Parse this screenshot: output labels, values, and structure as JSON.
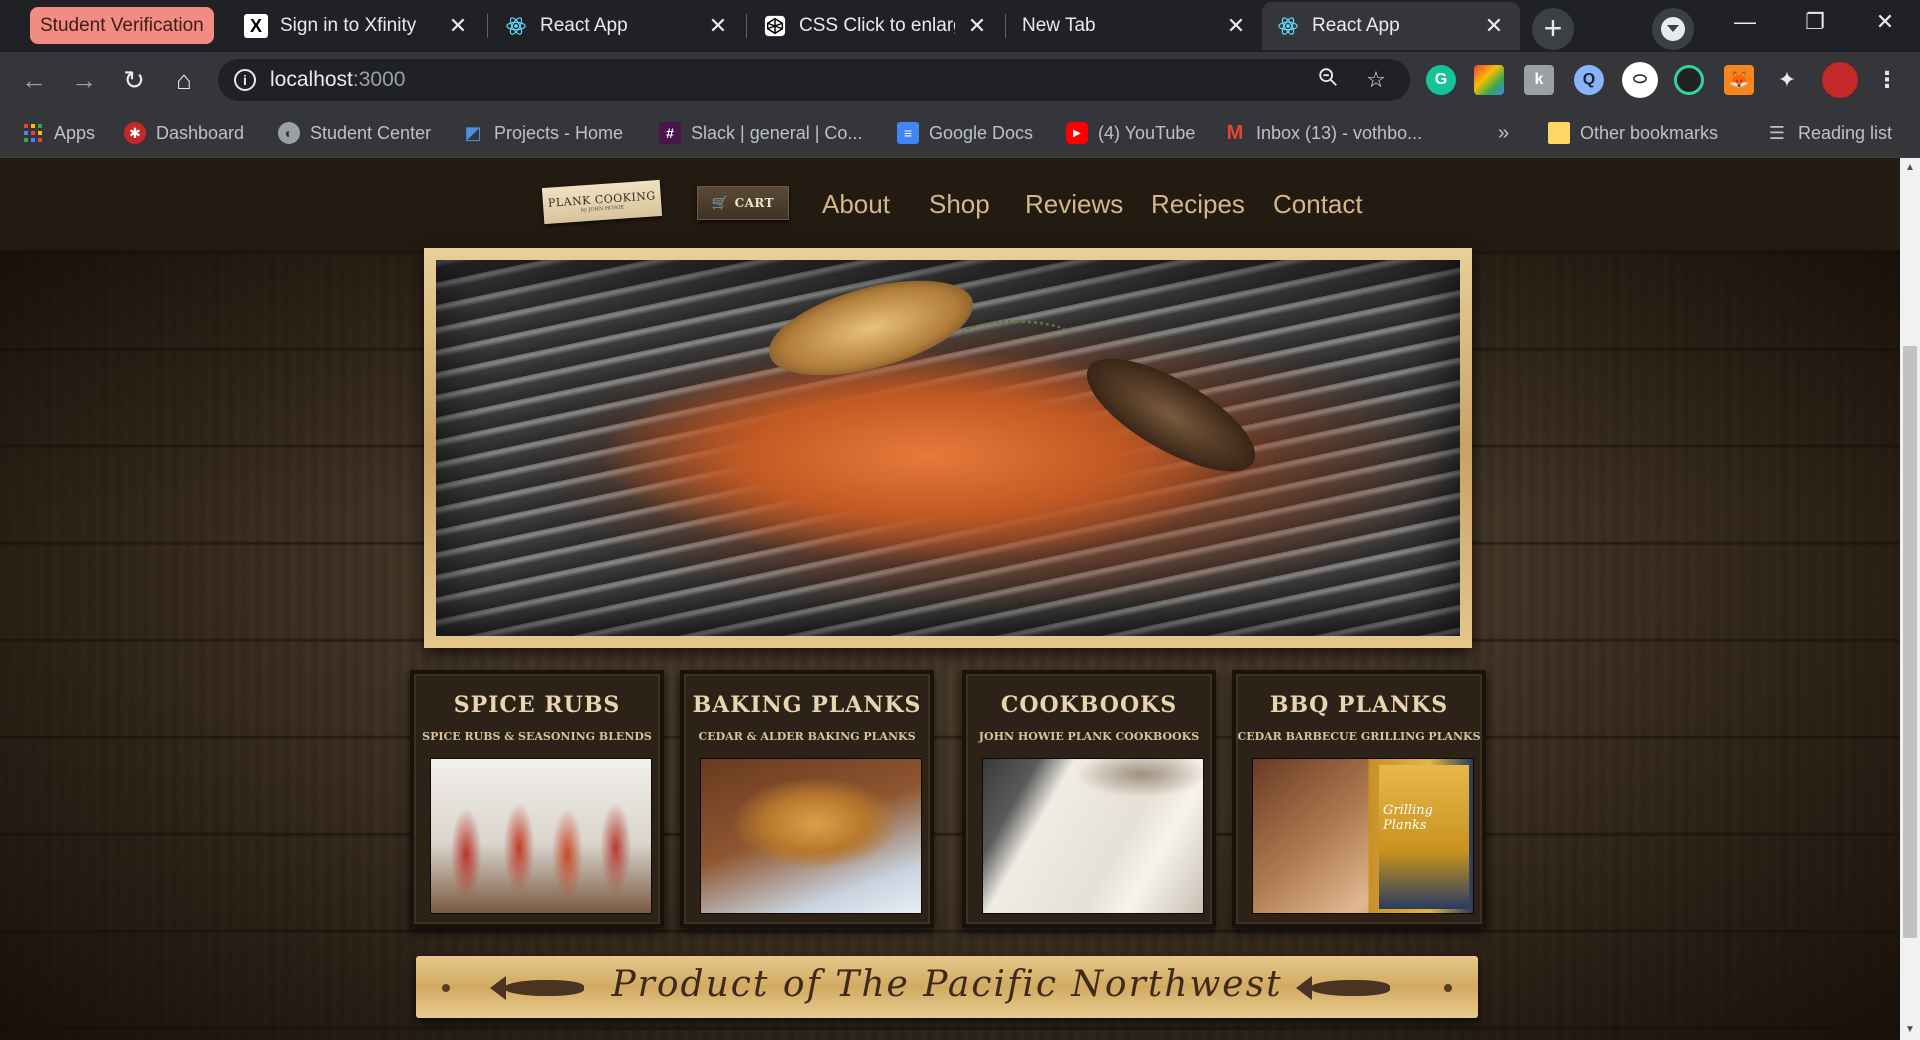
{
  "browser": {
    "tab_group_label": "Student Verification",
    "tabs": [
      {
        "title": "Sign in to Xfinity",
        "favicon": "x-logo-icon",
        "close": "✕"
      },
      {
        "title": "React App",
        "favicon": "react-icon",
        "close": "✕"
      },
      {
        "title": "CSS Click to enlarge",
        "favicon": "codepen-icon",
        "close": "✕"
      },
      {
        "title": "New Tab",
        "favicon": "",
        "close": "✕"
      },
      {
        "title": "React App",
        "favicon": "react-icon",
        "close": "✕",
        "active": true
      }
    ],
    "new_tab": "+",
    "window_controls": {
      "minimize": "—",
      "restore": "❐",
      "close": "✕"
    },
    "address": {
      "host": "localhost",
      "port": ":3000"
    },
    "bookmarks": [
      {
        "label": "Apps",
        "icon": "apps-grid-icon"
      },
      {
        "label": "Dashboard",
        "icon": "dashboard-icon"
      },
      {
        "label": "Student Center",
        "icon": "student-center-icon"
      },
      {
        "label": "Projects - Home",
        "icon": "azure-devops-icon"
      },
      {
        "label": "Slack | general | Co...",
        "icon": "slack-icon"
      },
      {
        "label": "Google Docs",
        "icon": "google-docs-icon"
      },
      {
        "label": "(4) YouTube",
        "icon": "youtube-icon"
      },
      {
        "label": "Inbox (13) - vothbo...",
        "icon": "gmail-icon"
      }
    ],
    "bookmarks_overflow": "»",
    "other_bookmarks": "Other bookmarks",
    "reading_list": "Reading list",
    "colors": {
      "tab_group": "#f28b82",
      "chrome_dark": "#202124",
      "chrome_toolbar": "#35363a"
    }
  },
  "site": {
    "logo": {
      "line1": "PLANK COOKING",
      "line2": "by JOHN HOWIE"
    },
    "cart_label": "CART",
    "nav": [
      "About",
      "Shop",
      "Reviews",
      "Recipes",
      "Contact"
    ],
    "products": [
      {
        "title": "SPICE RUBS",
        "subtitle": "SPICE RUBS & SEASONING BLENDS"
      },
      {
        "title": "BAKING PLANKS",
        "subtitle": "CEDAR & ALDER BAKING PLANKS"
      },
      {
        "title": "COOKBOOKS",
        "subtitle": "JOHN HOWIE PLANK COOKBOOKS"
      },
      {
        "title": "BBQ PLANKS",
        "subtitle": "CEDAR BARBECUE GRILLING PLANKS",
        "book_label": "Grilling Planks"
      }
    ],
    "banner": "Product of The Pacific Northwest",
    "colors": {
      "header_bg": "#231a12",
      "nav_text": "#d2b889",
      "card_title": "#e7d4b0"
    }
  }
}
